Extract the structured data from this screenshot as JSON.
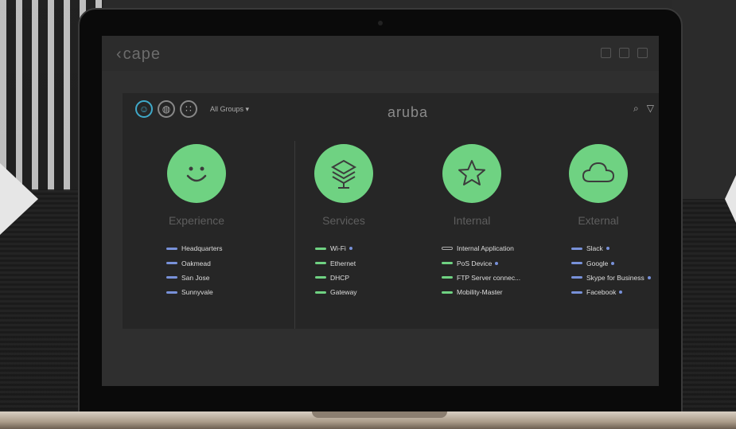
{
  "header": {
    "logo": "cape",
    "brand": "aruba"
  },
  "toolbar": {
    "groups_label": "All Groups",
    "icons": [
      "smiley-icon",
      "globe-icon",
      "apps-icon",
      "search-icon",
      "filter-icon"
    ]
  },
  "columns": [
    {
      "title": "Experience",
      "icon": "smiley-icon",
      "items": [
        {
          "label": "Headquarters",
          "status": "blue"
        },
        {
          "label": "Oakmead",
          "status": "blue"
        },
        {
          "label": "San Jose",
          "status": "blue"
        },
        {
          "label": "Sunnyvale",
          "status": "blue"
        }
      ]
    },
    {
      "title": "Services",
      "icon": "layers-icon",
      "items": [
        {
          "label": "Wi-Fi",
          "status": "green"
        },
        {
          "label": "Ethernet",
          "status": "green"
        },
        {
          "label": "DHCP",
          "status": "green"
        },
        {
          "label": "Gateway",
          "status": "green"
        }
      ]
    },
    {
      "title": "Internal",
      "icon": "star-icon",
      "items": [
        {
          "label": "Internal Application",
          "status": "outline"
        },
        {
          "label": "PoS Device",
          "status": "green"
        },
        {
          "label": "FTP Server connec...",
          "status": "green"
        },
        {
          "label": "Mobility-Master",
          "status": "green"
        }
      ]
    },
    {
      "title": "External",
      "icon": "cloud-icon",
      "items": [
        {
          "label": "Slack",
          "status": "blue"
        },
        {
          "label": "Google",
          "status": "blue"
        },
        {
          "label": "Skype for Business",
          "status": "blue"
        },
        {
          "label": "Facebook",
          "status": "green"
        }
      ]
    }
  ],
  "colors": {
    "accent": "#6fd282",
    "blue": "#7891d9",
    "active_ring": "#3fa9c9"
  }
}
